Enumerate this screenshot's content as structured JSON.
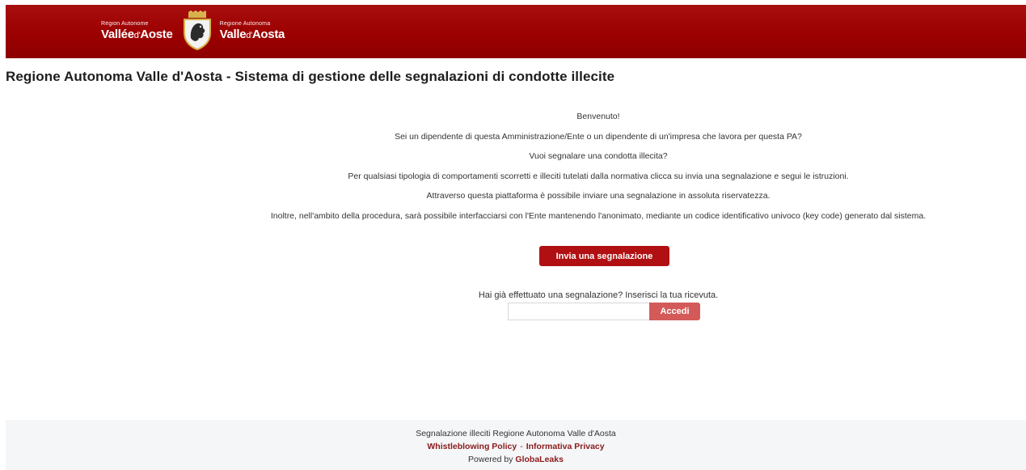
{
  "header": {
    "logo_left_small": "Région Autonome",
    "logo_left_big": "Vallée",
    "logo_left_big_d": "d'",
    "logo_left_big_2": "Aoste",
    "logo_right_small": "Regione Autonoma",
    "logo_right_big": "Valle",
    "logo_right_big_d": "d'",
    "logo_right_big_2": "Aosta",
    "bg_color": "#9c0000"
  },
  "page_title": "Regione Autonoma Valle d'Aosta - Sistema di gestione delle segnalazioni di condotte illecite",
  "intro": [
    "Benvenuto!",
    "Sei un dipendente di questa Amministrazione/Ente o un dipendente di un'impresa che lavora per questa PA?",
    "Vuoi segnalare una condotta illecita?",
    "Per qualsiasi tipologia di comportamenti scorretti e illeciti tutelati dalla normativa clicca su invia una segnalazione e segui le istruzioni.",
    "Attraverso questa piattaforma è possibile inviare una segnalazione in assoluta riservatezza.",
    "Inoltre, nell'ambito della procedura, sarà possibile interfacciarsi con l'Ente mantenendo l'anonimato, mediante un codice identificativo univoco (key code) generato dal sistema."
  ],
  "submit_button": "Invia una segnalazione",
  "receipt": {
    "prompt": "Hai già effettuato una segnalazione? Inserisci la tua ricevuta.",
    "input_value": "",
    "login_button": "Accedi"
  },
  "footer": {
    "line1": "Segnalazione illeciti Regione Autonoma Valle d'Aosta",
    "whistleblowing_link": "Whistleblowing Policy",
    "separator": "-",
    "privacy_link": "Informativa Privacy",
    "powered_by": "Powered by",
    "globaleaks_link": "GlobaLeaks"
  },
  "colors": {
    "brand_red": "#b01012",
    "accent_light_red": "#d45a5a",
    "footer_bg": "#f4f6f8",
    "link_red": "#8b1a1a"
  }
}
